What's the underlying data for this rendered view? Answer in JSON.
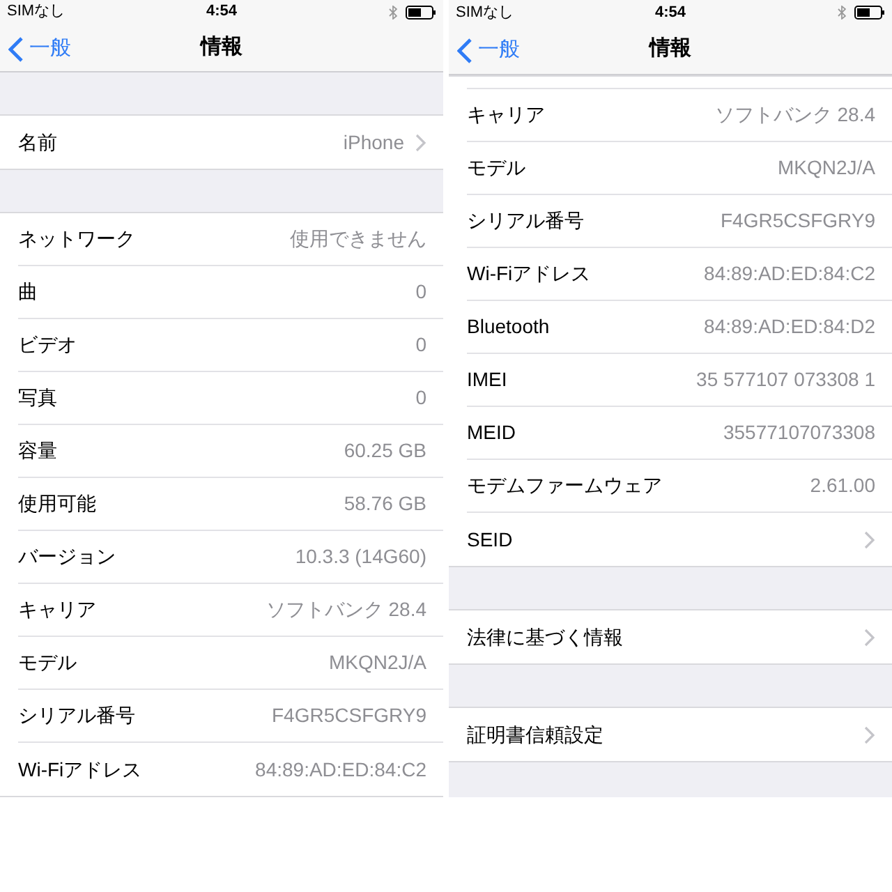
{
  "screens": [
    {
      "status_bar": {
        "carrier": "SIMなし",
        "time": "4:54"
      },
      "nav": {
        "back": "一般",
        "title": "情報"
      },
      "sections": [
        {
          "continued": false,
          "rows": [
            {
              "label": "名前",
              "value": "iPhone",
              "kind": "link"
            }
          ]
        },
        {
          "continued": false,
          "rows": [
            {
              "label": "ネットワーク",
              "value": "使用できません",
              "kind": "info"
            },
            {
              "label": "曲",
              "value": "0",
              "kind": "info"
            },
            {
              "label": "ビデオ",
              "value": "0",
              "kind": "info"
            },
            {
              "label": "写真",
              "value": "0",
              "kind": "info"
            },
            {
              "label": "容量",
              "value": "60.25 GB",
              "kind": "info"
            },
            {
              "label": "使用可能",
              "value": "58.76 GB",
              "kind": "info"
            },
            {
              "label": "バージョン",
              "value": "10.3.3 (14G60)",
              "kind": "info"
            },
            {
              "label": "キャリア",
              "value": "ソフトバンク 28.4",
              "kind": "info"
            },
            {
              "label": "モデル",
              "value": "MKQN2J/A",
              "kind": "info"
            },
            {
              "label": "シリアル番号",
              "value": "F4GR5CSFGRY9",
              "kind": "info"
            },
            {
              "label": "Wi-Fiアドレス",
              "value": "84:89:AD:ED:84:C2",
              "kind": "info"
            }
          ]
        }
      ]
    },
    {
      "status_bar": {
        "carrier": "SIMなし",
        "time": "4:54"
      },
      "nav": {
        "back": "一般",
        "title": "情報"
      },
      "sections": [
        {
          "continued": true,
          "rows": [
            {
              "label": "キャリア",
              "value": "ソフトバンク 28.4",
              "kind": "info"
            },
            {
              "label": "モデル",
              "value": "MKQN2J/A",
              "kind": "info"
            },
            {
              "label": "シリアル番号",
              "value": "F4GR5CSFGRY9",
              "kind": "info"
            },
            {
              "label": "Wi-Fiアドレス",
              "value": "84:89:AD:ED:84:C2",
              "kind": "info"
            },
            {
              "label": "Bluetooth",
              "value": "84:89:AD:ED:84:D2",
              "kind": "info"
            },
            {
              "label": "IMEI",
              "value": "35 577107 073308 1",
              "kind": "info"
            },
            {
              "label": "MEID",
              "value": "35577107073308",
              "kind": "info"
            },
            {
              "label": "モデムファームウェア",
              "value": "2.61.00",
              "kind": "info"
            },
            {
              "label": "SEID",
              "kind": "link"
            }
          ]
        },
        {
          "continued": false,
          "rows": [
            {
              "label": "法律に基づく情報",
              "kind": "link"
            }
          ]
        },
        {
          "continued": false,
          "rows": [
            {
              "label": "証明書信頼設定",
              "kind": "link"
            }
          ]
        }
      ]
    }
  ]
}
